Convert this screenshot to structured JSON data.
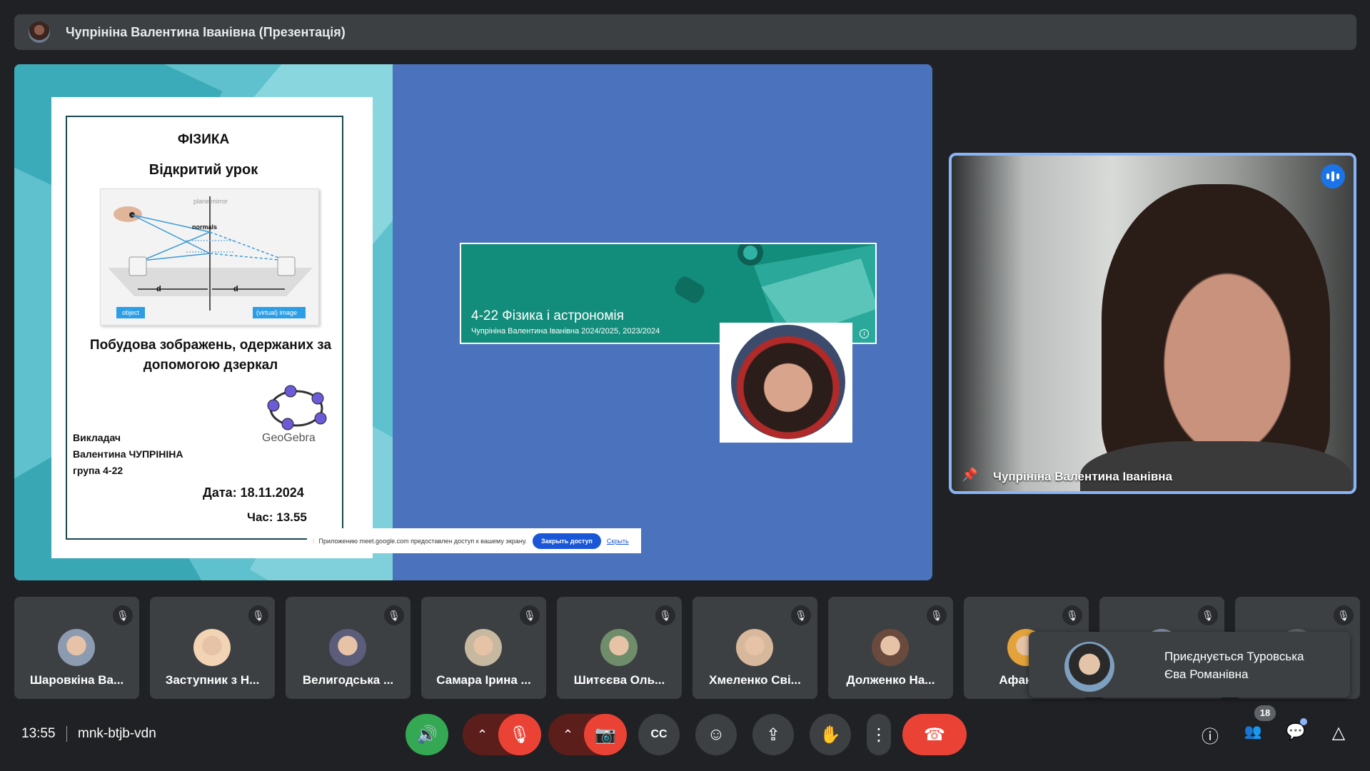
{
  "presenter_bar": {
    "title": "Чупрініна Валентина Іванівна (Презентація)"
  },
  "slide": {
    "subject": "ФІЗИКА",
    "lesson_type": "Відкритий урок",
    "diagram_labels": {
      "mirror": "plane mirror",
      "normals": "normals",
      "object": "object",
      "image": "(virtual) image",
      "do": "d",
      "di": "d"
    },
    "topic": "Побудова зображень, одержаних за допомогою дзеркал",
    "teacher_label": "Викладач",
    "teacher_name": "Валентина ЧУПРІНІНА",
    "group": "група 4-22",
    "geogebra": "GeoGebra",
    "date": "Дата: 18.11.2024",
    "time": "Час: 13.55"
  },
  "course_card": {
    "title": "4-22 Фізика і астрономія",
    "subtitle": "Чупрініна Валентина Іванівна 2024/2025, 2023/2024",
    "info_icon": "i"
  },
  "share_bar": {
    "grip": "⁞",
    "message": "Приложению meet.google.com предоставлен доступ к вашему экрану.",
    "stop_label": "Закрыть доступ",
    "hide_label": "Скрыть"
  },
  "speaker": {
    "name": "Чупрініна Валентина Іванівна"
  },
  "participants": [
    {
      "name": "Шаровкіна Ва...",
      "avatar_color": "#8d9bb0"
    },
    {
      "name": "Заступник з Н...",
      "avatar_color": "#f2d3b3"
    },
    {
      "name": "Велигодська ...",
      "avatar_color": "#5b5d7a"
    },
    {
      "name": "Самара Ірина ...",
      "avatar_color": "#c7b9a0"
    },
    {
      "name": "Шитєєва Оль...",
      "avatar_color": "#6f8d6a"
    },
    {
      "name": "Хмеленко Сві...",
      "avatar_color": "#d7b89c"
    },
    {
      "name": "Долженко На...",
      "avatar_color": "#6b4a3e"
    },
    {
      "name": "Афанась",
      "avatar_color": "#e3a23a"
    },
    {
      "name": "",
      "avatar_color": "#7f8fa8"
    },
    {
      "name": "",
      "avatar_color": "#5f6368"
    }
  ],
  "join_toast": {
    "text_line1": "Приєднується Туровська",
    "text_line2": "Єва Романівна"
  },
  "bottom_bar": {
    "clock": "13:55",
    "meeting_code": "mnk-btjb-vdn",
    "participants_count": "18"
  },
  "icons": {
    "mute": "🎙",
    "speaker": "🔊",
    "chevron": "⌃",
    "mic_off": "🎙",
    "cam_off": "📷",
    "captions": "CC",
    "emoji": "☺",
    "present": "⇪",
    "hand": "✋",
    "more": "⋮",
    "hangup": "☎",
    "info": "ⓘ",
    "people": "👥",
    "chat": "💬",
    "activities": "△",
    "pin": "📌"
  },
  "colors": {
    "accent": "#8ab4f8",
    "danger": "#ea4335",
    "success": "#34a853"
  }
}
